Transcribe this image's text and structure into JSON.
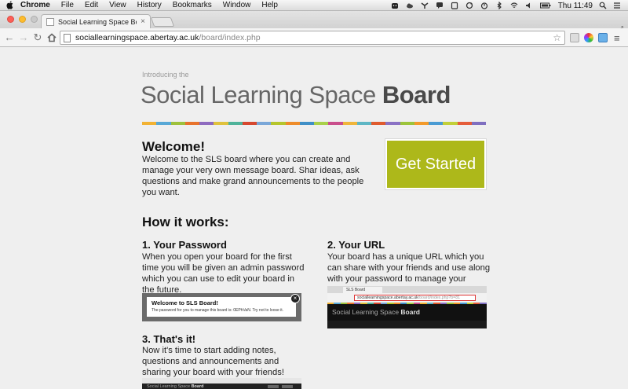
{
  "menubar": {
    "app_name": "Chrome",
    "items": [
      "File",
      "Edit",
      "View",
      "History",
      "Bookmarks",
      "Window",
      "Help"
    ],
    "clock": "Thu 11:49"
  },
  "browser": {
    "tab_title": "Social Learning Space Boa",
    "url_host": "sociallearningspace.abertay.ac.uk",
    "url_path": "/board/index.php"
  },
  "page": {
    "intro": "Introducing the",
    "title_light": "Social Learning Space ",
    "title_bold": "Board",
    "stripe_colors": [
      "#f2b233",
      "#58a8d6",
      "#9ec13c",
      "#e8732c",
      "#8e6bbf",
      "#e0c23c",
      "#4fb39a",
      "#d6482f",
      "#7aa7d8",
      "#b5c52c",
      "#ee8c2a",
      "#3f8fc7",
      "#a9d04a",
      "#c94e8c",
      "#f0b53a",
      "#5eb6c4",
      "#df5b2e",
      "#8a72c4",
      "#9cc43b",
      "#f39a2b",
      "#4a9bd3",
      "#c2cf38",
      "#e55d3a",
      "#7f6fc0"
    ],
    "welcome_heading": "Welcome!",
    "welcome_text": "Welcome to the SLS board where you can create and manage your very own message board. Shar ideas, ask questions and make grand announcements to the people you want.",
    "cta_label": "Get Started",
    "how_heading": "How it works:",
    "steps": [
      {
        "heading": "1. Your Password",
        "text": "When you open your board for the first time you will be given an admin password which you can use to edit your board in the future."
      },
      {
        "heading": "2. Your URL",
        "text": "Your board has a unique URL which you can share with your friends and use along with your password to manage your board."
      },
      {
        "heading": "3. That's it!",
        "text": "Now it's time to start adding notes, questions and announcements and sharing your board with your friends!"
      }
    ],
    "shot1": {
      "title": "Welcome to SLS Board!",
      "text": "The password for you to manage this board is:   0EPhVaN.  Try not to loose it."
    },
    "shot2": {
      "tab": "SLS Board",
      "url_host": "sociallearningspace.abertay.ac.uk",
      "url_path": "/board/index.php?b=81",
      "title_light": "Social Learning Space ",
      "title_bold": "Board"
    },
    "shot3": {
      "title_light": "Social Learning Space ",
      "title_bold": "Board"
    }
  }
}
